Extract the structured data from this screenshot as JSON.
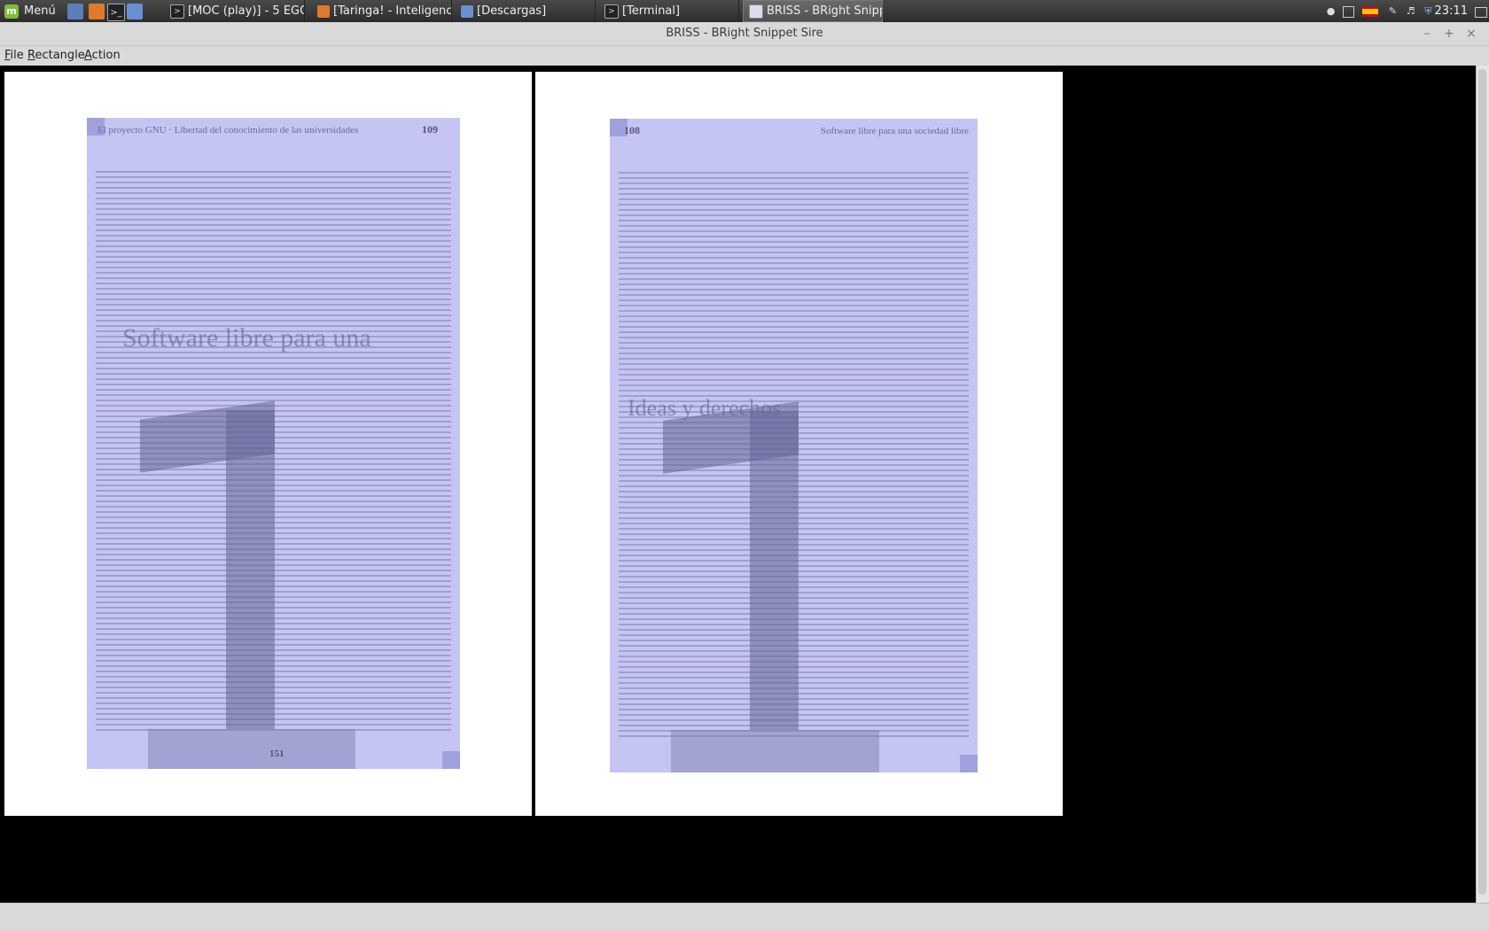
{
  "taskbar": {
    "menu_label": "Menú",
    "tasks": [
      {
        "label": "[MOC (play)] - 5 EGOI..."
      },
      {
        "label": "[Taringa! - Inteligenci..."
      },
      {
        "label": "[Descargas]"
      },
      {
        "label": "[Terminal]"
      },
      {
        "label": "BRISS - BRight Snipp..."
      }
    ],
    "clock": "23:11",
    "tray_icons": [
      "user-icon",
      "network-icon",
      "spain-flag-icon",
      "pen-icon",
      "volume-icon",
      "shield-icon",
      "display-icon"
    ]
  },
  "window": {
    "title": "BRISS - BRight Snippet Sire"
  },
  "menubar": {
    "items": [
      {
        "label": "File",
        "accel": "F",
        "rest": "ile"
      },
      {
        "label": "Rectangle",
        "accel": "R",
        "rest": "ectangle"
      },
      {
        "label": "Action",
        "accel": "A",
        "rest": "ction"
      }
    ]
  },
  "pages": [
    {
      "header_text": "El proyecto GNU · Libertad del conocimiento de las universidades",
      "page_number": "109",
      "footer_number": "151",
      "ghost_title": "Software libre para una"
    },
    {
      "header_text": "Software libre para una sociedad libre",
      "page_number": "108",
      "footer_number": "",
      "ghost_title": "Ideas y derechos"
    }
  ]
}
